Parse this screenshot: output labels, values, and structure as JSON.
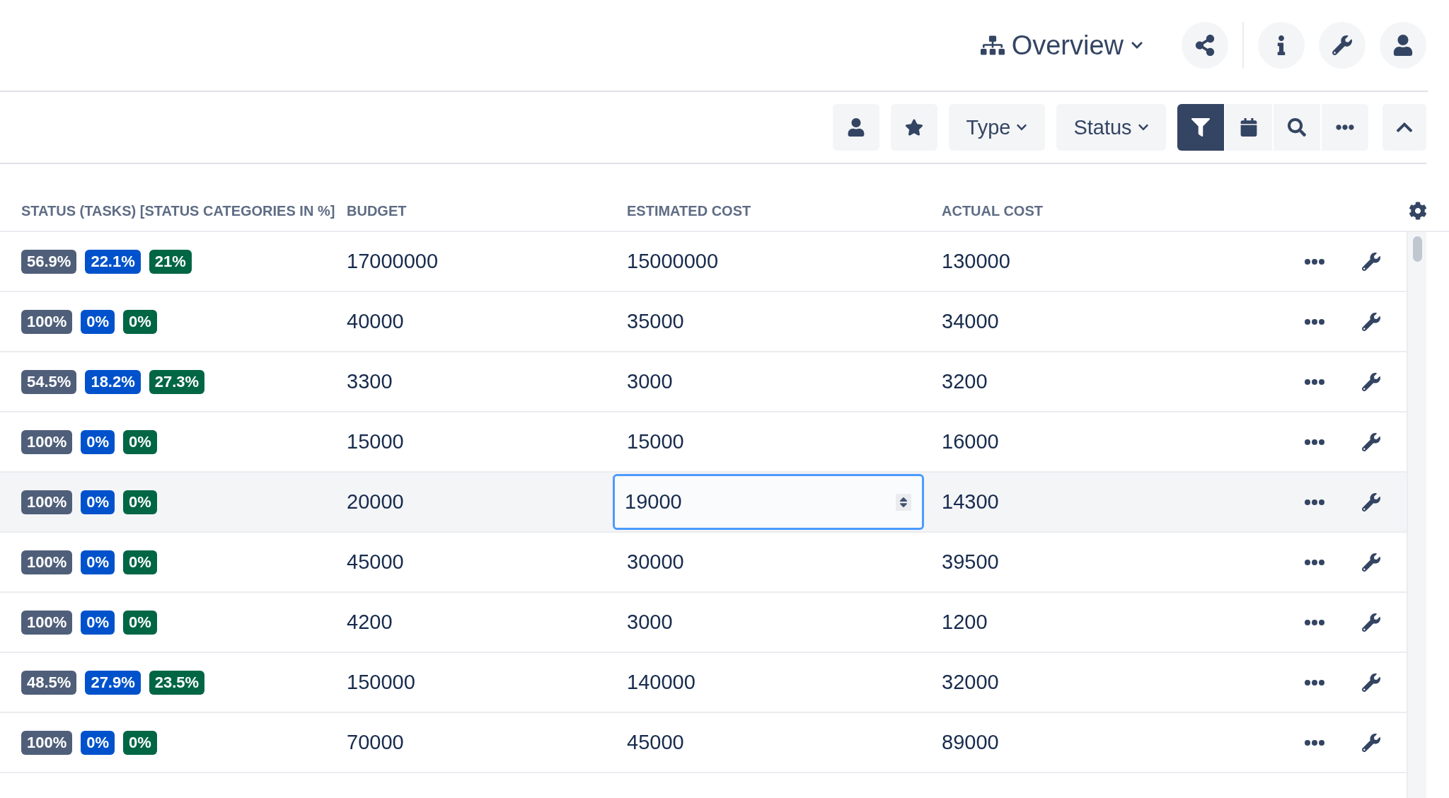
{
  "header": {
    "view_label": "Overview"
  },
  "toolbar": {
    "type_label": "Type",
    "status_label": "Status",
    "filter_active": true
  },
  "table": {
    "columns": [
      "STATUS (TASKS) [STATUS CATEGORIES IN %]",
      "BUDGET",
      "ESTIMATED COST",
      "ACTUAL COST"
    ],
    "rows": [
      {
        "status": [
          {
            "text": "56.9%",
            "color": "#505f79"
          },
          {
            "text": "22.1%",
            "color": "#0052cc"
          },
          {
            "text": "21%",
            "color": "#006644"
          }
        ],
        "budget": "17000000",
        "estimated_cost": "15000000",
        "actual_cost": "130000",
        "editing": false
      },
      {
        "status": [
          {
            "text": "100%",
            "color": "#505f79"
          },
          {
            "text": "0%",
            "color": "#0052cc"
          },
          {
            "text": "0%",
            "color": "#006644"
          }
        ],
        "budget": "40000",
        "estimated_cost": "35000",
        "actual_cost": "34000",
        "editing": false
      },
      {
        "status": [
          {
            "text": "54.5%",
            "color": "#505f79"
          },
          {
            "text": "18.2%",
            "color": "#0052cc"
          },
          {
            "text": "27.3%",
            "color": "#006644"
          }
        ],
        "budget": "3300",
        "estimated_cost": "3000",
        "actual_cost": "3200",
        "editing": false
      },
      {
        "status": [
          {
            "text": "100%",
            "color": "#505f79"
          },
          {
            "text": "0%",
            "color": "#0052cc"
          },
          {
            "text": "0%",
            "color": "#006644"
          }
        ],
        "budget": "15000",
        "estimated_cost": "15000",
        "actual_cost": "16000",
        "editing": false
      },
      {
        "status": [
          {
            "text": "100%",
            "color": "#505f79"
          },
          {
            "text": "0%",
            "color": "#0052cc"
          },
          {
            "text": "0%",
            "color": "#006644"
          }
        ],
        "budget": "20000",
        "estimated_cost": "19000",
        "actual_cost": "14300",
        "editing": true
      },
      {
        "status": [
          {
            "text": "100%",
            "color": "#505f79"
          },
          {
            "text": "0%",
            "color": "#0052cc"
          },
          {
            "text": "0%",
            "color": "#006644"
          }
        ],
        "budget": "45000",
        "estimated_cost": "30000",
        "actual_cost": "39500",
        "editing": false
      },
      {
        "status": [
          {
            "text": "100%",
            "color": "#505f79"
          },
          {
            "text": "0%",
            "color": "#0052cc"
          },
          {
            "text": "0%",
            "color": "#006644"
          }
        ],
        "budget": "4200",
        "estimated_cost": "3000",
        "actual_cost": "1200",
        "editing": false
      },
      {
        "status": [
          {
            "text": "48.5%",
            "color": "#505f79"
          },
          {
            "text": "27.9%",
            "color": "#0052cc"
          },
          {
            "text": "23.5%",
            "color": "#006644"
          }
        ],
        "budget": "150000",
        "estimated_cost": "140000",
        "actual_cost": "32000",
        "editing": false
      },
      {
        "status": [
          {
            "text": "100%",
            "color": "#505f79"
          },
          {
            "text": "0%",
            "color": "#0052cc"
          },
          {
            "text": "0%",
            "color": "#006644"
          }
        ],
        "budget": "70000",
        "estimated_cost": "45000",
        "actual_cost": "89000",
        "editing": false
      }
    ]
  }
}
